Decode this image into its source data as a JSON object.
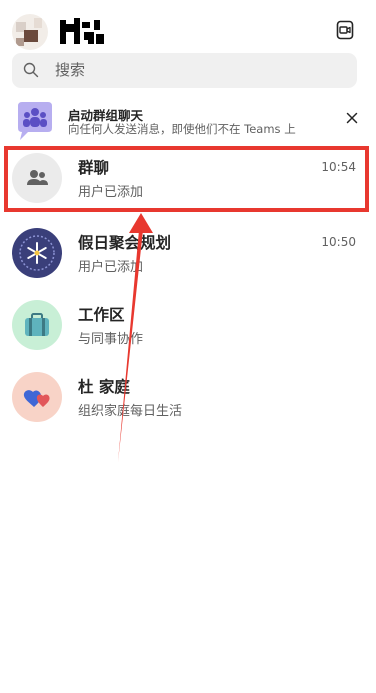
{
  "header": {
    "avatar_icon": "avatar",
    "video_icon": "video-call-icon"
  },
  "search": {
    "placeholder": "搜索",
    "icon": "search-icon"
  },
  "banner": {
    "title": "启动群组聊天",
    "subtitle": "向任何人发送消息，即使他们不在 Teams 上",
    "icon": "people-group-icon",
    "close_icon": "close-icon"
  },
  "chats": [
    {
      "title": "群聊",
      "subtitle": "用户已添加",
      "time": "10:54",
      "icon": "people-icon"
    },
    {
      "title": "假日聚会规划",
      "subtitle": "用户已添加",
      "time": "10:50",
      "icon": "snowflake-icon"
    },
    {
      "title": "工作区",
      "subtitle": "与同事协作",
      "time": "",
      "icon": "briefcase-icon"
    },
    {
      "title": "杜 家庭",
      "subtitle": "组织家庭每日生活",
      "time": "",
      "icon": "hearts-icon"
    }
  ],
  "colors": {
    "highlight": "#e8382f",
    "banner_purple": "#b7aef0",
    "holiday_bg": "#3a3f7a",
    "workspace_bg": "#c8efd6",
    "family_bg": "#f8d3c7"
  }
}
